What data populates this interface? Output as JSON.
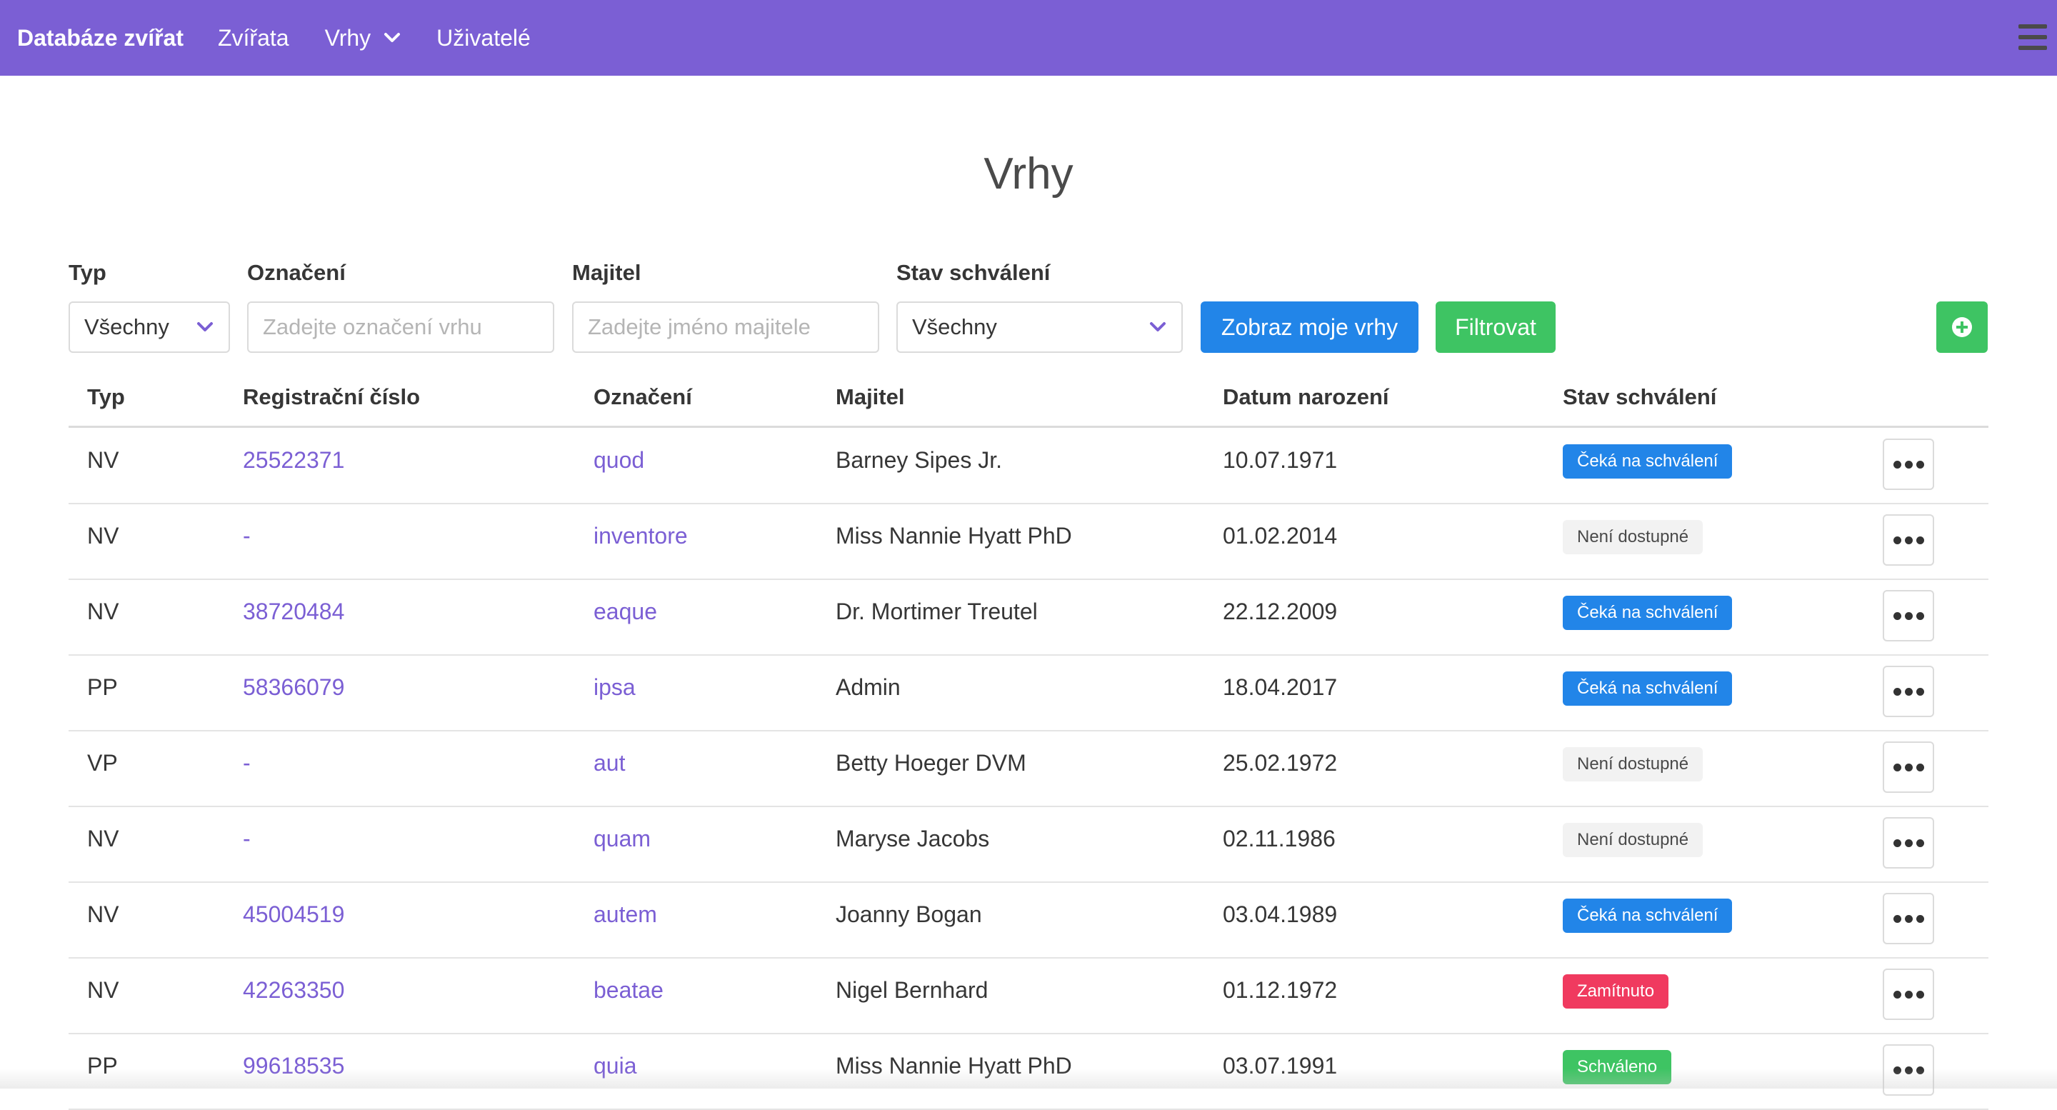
{
  "navbar": {
    "brand": "Databáze zvířat",
    "items": [
      {
        "label": "Zvířata"
      },
      {
        "label": "Vrhy"
      },
      {
        "label": "Uživatelé"
      }
    ]
  },
  "page_title": "Vrhy",
  "filters": {
    "type": {
      "label": "Typ",
      "value": "Všechny"
    },
    "designation": {
      "label": "Označení",
      "placeholder": "Zadejte označení vrhu"
    },
    "owner": {
      "label": "Majitel",
      "placeholder": "Zadejte jméno majitele"
    },
    "approval": {
      "label": "Stav schválení",
      "value": "Všechny"
    },
    "show_mine_label": "Zobraz moje vrhy",
    "filter_label": "Filtrovat"
  },
  "table": {
    "headers": [
      "Typ",
      "Registrační číslo",
      "Označení",
      "Majitel",
      "Datum narození",
      "Stav schválení"
    ],
    "rows": [
      {
        "type": "NV",
        "reg": "25522371",
        "designation": "quod",
        "owner": "Barney Sipes Jr.",
        "born": "10.07.1971",
        "status": "Čeká na schválení",
        "status_kind": "pending"
      },
      {
        "type": "NV",
        "reg": "-",
        "designation": "inventore",
        "owner": "Miss Nannie Hyatt PhD",
        "born": "01.02.2014",
        "status": "Není dostupné",
        "status_kind": "na"
      },
      {
        "type": "NV",
        "reg": "38720484",
        "designation": "eaque",
        "owner": "Dr. Mortimer Treutel",
        "born": "22.12.2009",
        "status": "Čeká na schválení",
        "status_kind": "pending"
      },
      {
        "type": "PP",
        "reg": "58366079",
        "designation": "ipsa",
        "owner": "Admin",
        "born": "18.04.2017",
        "status": "Čeká na schválení",
        "status_kind": "pending"
      },
      {
        "type": "VP",
        "reg": "-",
        "designation": "aut",
        "owner": "Betty Hoeger DVM",
        "born": "25.02.1972",
        "status": "Není dostupné",
        "status_kind": "na"
      },
      {
        "type": "NV",
        "reg": "-",
        "designation": "quam",
        "owner": "Maryse Jacobs",
        "born": "02.11.1986",
        "status": "Není dostupné",
        "status_kind": "na"
      },
      {
        "type": "NV",
        "reg": "45004519",
        "designation": "autem",
        "owner": "Joanny Bogan",
        "born": "03.04.1989",
        "status": "Čeká na schválení",
        "status_kind": "pending"
      },
      {
        "type": "NV",
        "reg": "42263350",
        "designation": "beatae",
        "owner": "Nigel Bernhard",
        "born": "01.12.1972",
        "status": "Zamítnuto",
        "status_kind": "rejected"
      },
      {
        "type": "PP",
        "reg": "99618535",
        "designation": "quia",
        "owner": "Miss Nannie Hyatt PhD",
        "born": "03.07.1991",
        "status": "Schváleno",
        "status_kind": "approved"
      }
    ]
  },
  "colors": {
    "navbar": "#7b5fd4",
    "link": "#7b5fd4",
    "primary_button": "#2285e8",
    "success_button": "#3ec463",
    "badge_pending": "#2285e8",
    "badge_na": "#f2f2f2",
    "badge_rejected": "#f03a5f",
    "badge_approved": "#3ec463"
  },
  "icons": {
    "nav_dropdown": "chevron-down-icon",
    "menu": "hamburger-icon",
    "add": "plus-circle-icon",
    "row_actions": "ellipsis-icon"
  }
}
